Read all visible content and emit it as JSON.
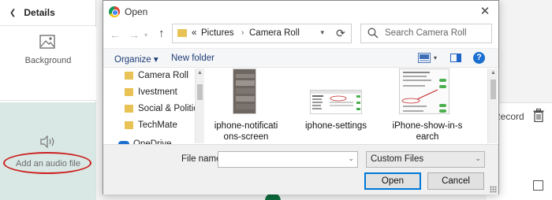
{
  "background_app": {
    "details_label": "Details",
    "background_label": "Background",
    "audio_label": "Add an audio file",
    "record_label": "Record",
    "colors": {
      "audio_tile": "#d9e8e4",
      "highlight_oval": "#cc1f1f",
      "fab": "#0f6e3e"
    }
  },
  "dialog": {
    "title": "Open",
    "close_icon": "close-icon",
    "address": {
      "overflow": "«",
      "crumbs": [
        "Pictures",
        "Camera Roll"
      ]
    },
    "search": {
      "placeholder": "Search Camera Roll"
    },
    "toolbar": {
      "organize": "Organize ▾",
      "new_folder": "New folder"
    },
    "nav_items": [
      "Camera Roll",
      "Ivestment",
      "Social & Politica",
      "TechMate"
    ],
    "nav_partial": "OneDrive",
    "files": [
      {
        "name_line1": "iphone-notificati",
        "name_line2": "ons-screen"
      },
      {
        "name_line1": "iphone-settings",
        "name_line2": ""
      },
      {
        "name_line1": "iPhone-show-in-s",
        "name_line2": "earch"
      }
    ],
    "file_name": {
      "label": "File name:",
      "value": ""
    },
    "file_type": {
      "selected": "Custom Files"
    },
    "buttons": {
      "open": "Open",
      "cancel": "Cancel"
    },
    "colors": {
      "link": "#1e3d78",
      "accent": "#0078d7",
      "folder": "#e8c254"
    }
  }
}
